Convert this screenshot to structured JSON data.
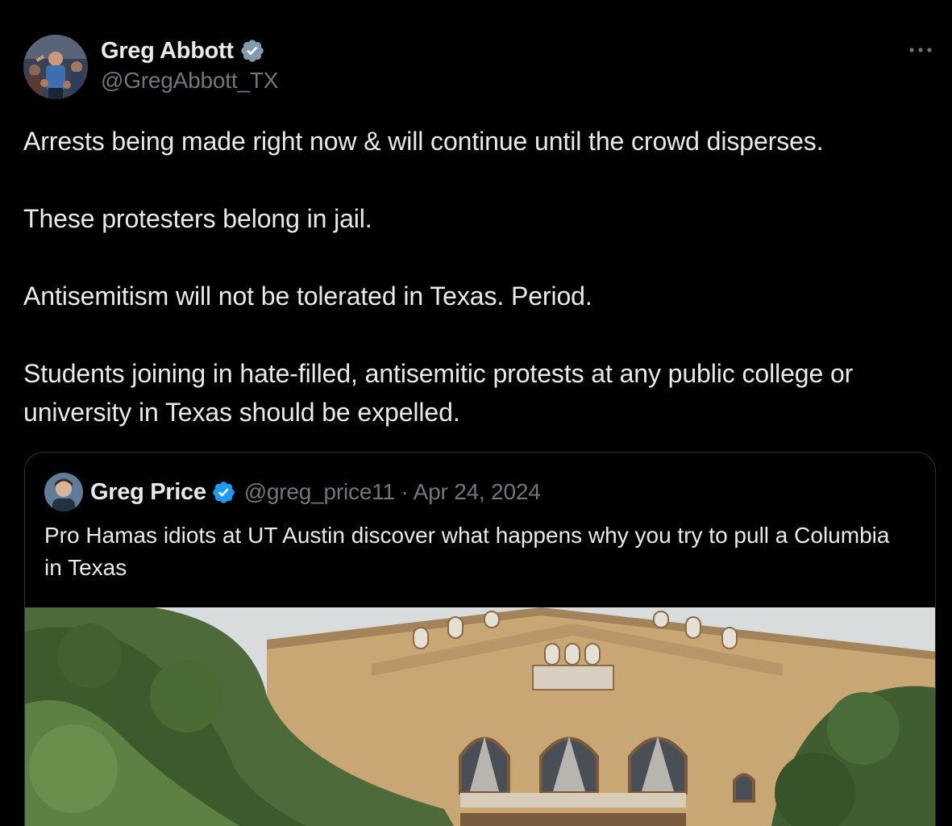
{
  "post": {
    "author": {
      "display_name": "Greg Abbott",
      "handle": "@GregAbbott_TX",
      "verified": true,
      "verified_icon": "verified-badge-icon"
    },
    "more_icon": "more-options-icon",
    "paragraphs": [
      "Arrests being made right now & will continue until the crowd disperses.",
      "These protesters belong in jail.",
      "Antisemitism will not be tolerated in Texas. Period.",
      "Students joining in hate-filled, antisemitic protests at any public college or university in Texas should be expelled."
    ]
  },
  "quoted_post": {
    "display_name": "Greg Price",
    "handle": "@greg_price11",
    "separator": "·",
    "date": "Apr 24, 2024",
    "verified": true,
    "text": "Pro Hamas idiots at UT Austin discover what happens why you try to pull a Columbia in Texas",
    "media": "building-photo"
  },
  "colors": {
    "background": "#000000",
    "text_primary": "#e7e9ea",
    "text_secondary": "#71767b",
    "border": "#2f3336",
    "verified_blue": "#1d9bf0",
    "verified_gray": "#829aab"
  }
}
